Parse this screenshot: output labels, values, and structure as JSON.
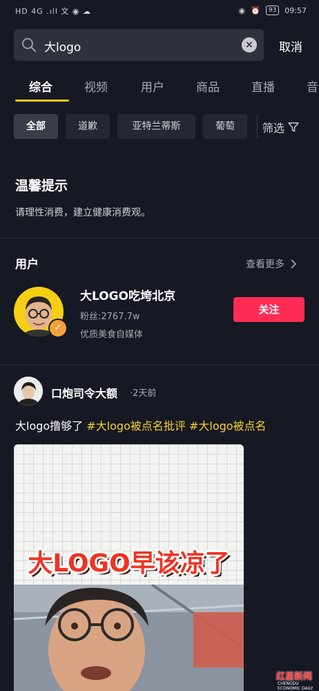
{
  "status_bar": {
    "left_icons": "HD 4G .ıll 文 ◉ ☁",
    "battery": "93",
    "time": "09:57"
  },
  "search": {
    "query": "大logo",
    "cancel_label": "取消"
  },
  "tabs": [
    "综合",
    "视频",
    "用户",
    "商品",
    "直播",
    "音"
  ],
  "chips": [
    "全部",
    "道歉",
    "亚特兰蒂斯",
    "葡萄"
  ],
  "filter_label": "筛选",
  "tip": {
    "title": "温馨提示",
    "text": "请理性消费，建立健康消费观。"
  },
  "users_section": {
    "title": "用户",
    "see_more": "查看更多",
    "user": {
      "name": "大LOGO吃垮北京",
      "fans": "粉丝:2767.7w",
      "desc": "优质美食自媒体",
      "follow_label": "关注"
    }
  },
  "post": {
    "author": "口炮司令大额",
    "time": "·2天前",
    "text_plain": "大logo撸够了 ",
    "tag1": "#大logo被点名批评",
    "tag2": " #大logo被点名",
    "video_caption": "大LOGO早该凉了"
  },
  "watermark": {
    "text": "红星新闻",
    "sub": "CHENGDU ECONOMIC DAILY"
  },
  "colors": {
    "background": "#161823",
    "accent_yellow": "#face15",
    "follow_red": "#fe2c55",
    "tag_yellow": "#f5d12b"
  }
}
